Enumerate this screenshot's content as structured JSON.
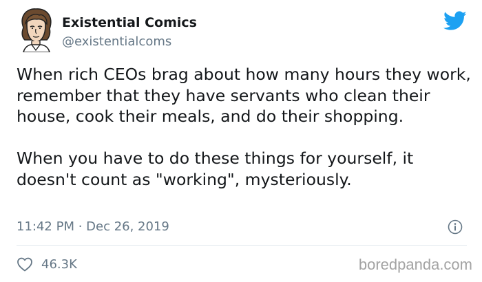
{
  "author": {
    "display_name": "Existential Comics",
    "handle": "@existentialcoms",
    "avatar_icon": "cartoon-portrait-avatar"
  },
  "tweet": {
    "paragraph_1": "When rich CEOs brag about how many hours they work, remember that they have servants who clean their house, cook their meals, and do their shopping.",
    "paragraph_2": "When you have to do these things for yourself, it doesn't count as \"working\", mysteriously.",
    "timestamp": "11:42 PM · Dec 26, 2019"
  },
  "actions": {
    "like_icon": "heart-icon",
    "like_count": "46.3K",
    "info_icon": "info-icon"
  },
  "branding": {
    "twitter_icon": "twitter-bird-icon",
    "twitter_color": "#1da1f2",
    "watermark": "boredpanda.com"
  },
  "colors": {
    "text": "#14171a",
    "secondary": "#657786",
    "divider": "#e1e8ed"
  }
}
